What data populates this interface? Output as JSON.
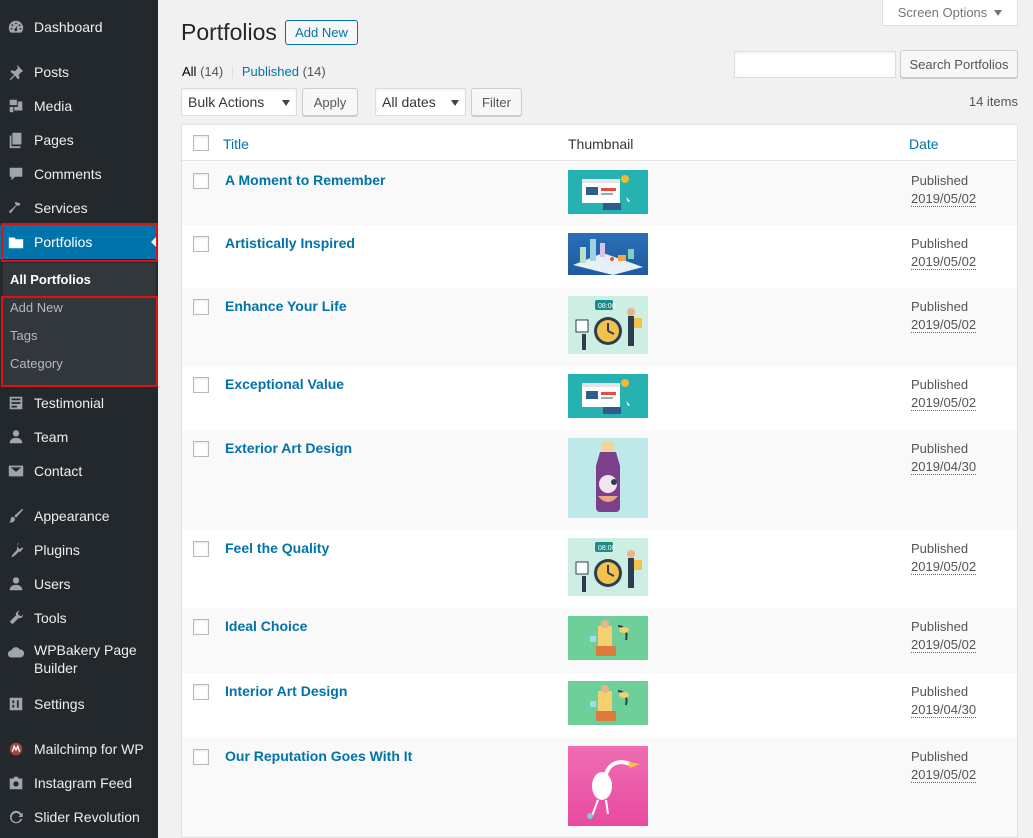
{
  "sidebar": {
    "items": [
      {
        "label": "Dashboard",
        "icon": "dashboard-icon"
      },
      {
        "label": "Posts",
        "icon": "pushpin-icon"
      },
      {
        "label": "Media",
        "icon": "media-icon"
      },
      {
        "label": "Pages",
        "icon": "pages-icon"
      },
      {
        "label": "Comments",
        "icon": "comment-icon"
      },
      {
        "label": "Services",
        "icon": "hammer-icon"
      },
      {
        "label": "Portfolios",
        "icon": "folder-icon"
      },
      {
        "label": "Testimonial",
        "icon": "testimonial-icon"
      },
      {
        "label": "Team",
        "icon": "person-icon"
      },
      {
        "label": "Contact",
        "icon": "envelope-icon"
      },
      {
        "label": "Appearance",
        "icon": "paintbrush-icon"
      },
      {
        "label": "Plugins",
        "icon": "plug-icon"
      },
      {
        "label": "Users",
        "icon": "users-icon"
      },
      {
        "label": "Tools",
        "icon": "wrench-icon"
      },
      {
        "label": "WPBakery Page",
        "label2": "Builder",
        "icon": "cloud-icon"
      },
      {
        "label": "Settings",
        "icon": "settings-icon"
      },
      {
        "label": "Mailchimp for WP",
        "icon": "mailchimp-icon"
      },
      {
        "label": "Instagram Feed",
        "icon": "camera-icon"
      },
      {
        "label": "Slider Revolution",
        "icon": "refresh-icon"
      }
    ],
    "submenu": [
      "All Portfolios",
      "Add New",
      "Tags",
      "Category"
    ]
  },
  "header": {
    "title": "Portfolios",
    "add_new": "Add New",
    "screen_options": "Screen Options"
  },
  "filters": {
    "all_label": "All",
    "all_count": "(14)",
    "separator": "|",
    "published_label": "Published",
    "published_count": "(14)"
  },
  "search": {
    "value": "",
    "button": "Search Portfolios"
  },
  "toolbar": {
    "bulk_actions": "Bulk Actions",
    "apply": "Apply",
    "all_dates": "All dates",
    "filter": "Filter",
    "items_count": "14 items"
  },
  "table": {
    "columns": [
      "Title",
      "Thumbnail",
      "Date"
    ],
    "rows": [
      {
        "title": "A Moment to Remember",
        "status": "Published",
        "date": "2019/05/02",
        "thumb": "browser-illustration"
      },
      {
        "title": "Artistically Inspired",
        "status": "Published",
        "date": "2019/05/02",
        "thumb": "isometric-city-illustration"
      },
      {
        "title": "Enhance Your Life",
        "status": "Published",
        "date": "2019/05/02",
        "thumb": "clock-team-illustration"
      },
      {
        "title": "Exceptional Value",
        "status": "Published",
        "date": "2019/05/02",
        "thumb": "browser-illustration"
      },
      {
        "title": "Exterior Art Design",
        "status": "Published",
        "date": "2019/04/30",
        "thumb": "bottle-illustration"
      },
      {
        "title": "Feel the Quality",
        "status": "Published",
        "date": "2019/05/02",
        "thumb": "clock-team-illustration"
      },
      {
        "title": "Ideal Choice",
        "status": "Published",
        "date": "2019/05/02",
        "thumb": "plant-person-illustration"
      },
      {
        "title": "Interior Art Design",
        "status": "Published",
        "date": "2019/04/30",
        "thumb": "plant-person-illustration"
      },
      {
        "title": "Our Reputation Goes With It",
        "status": "Published",
        "date": "2019/05/02",
        "thumb": "flamingo-illustration"
      }
    ]
  },
  "colors": {
    "sidebar_bg": "#23282d",
    "submenu_bg": "#32373c",
    "accent": "#0073aa",
    "highlight_box": "#e01010"
  }
}
